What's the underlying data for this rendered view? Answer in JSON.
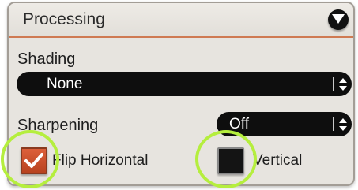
{
  "panel": {
    "title": "Processing",
    "collapse_icon": "chevron-down-icon"
  },
  "shading": {
    "label": "Shading",
    "value": "None"
  },
  "sharpening": {
    "label": "Sharpening",
    "value": "Off"
  },
  "flip_horizontal": {
    "label": "Flip Horizontal",
    "checked": true
  },
  "vertical": {
    "label": "Vertical",
    "checked": false
  },
  "colors": {
    "accent": "#d35a34",
    "highlight": "#b5ee3e",
    "control_bg": "#0e0e0e"
  }
}
